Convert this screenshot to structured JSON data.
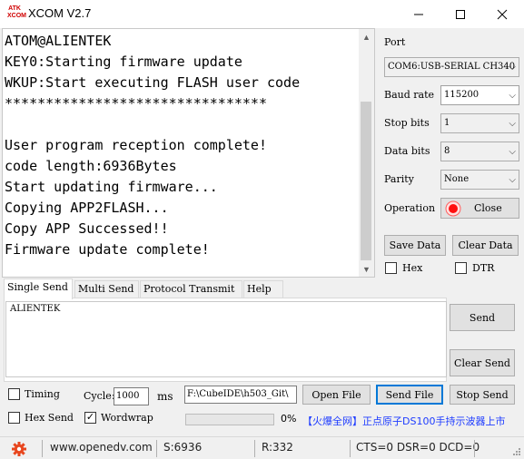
{
  "window": {
    "title": "XCOM V2.7",
    "logo_text": "ATK\nXCOM"
  },
  "receive": {
    "lines": [
      "ATOM@ALIENTEK",
      "KEY0:Starting firmware update",
      "WKUP:Start executing FLASH user code",
      "********************************",
      "",
      "User program reception complete!",
      "code length:6936Bytes",
      "Start updating firmware...",
      "Copying APP2FLASH...",
      "Copy APP Successed!!",
      "Firmware update complete!"
    ]
  },
  "settings": {
    "port_label": "Port",
    "port_value": "COM6:USB-SERIAL CH340",
    "baud_label": "Baud rate",
    "baud_value": "115200",
    "stopbits_label": "Stop bits",
    "stopbits_value": "1",
    "databits_label": "Data bits",
    "databits_value": "8",
    "parity_label": "Parity",
    "parity_value": "None",
    "operation_label": "Operation",
    "operation_button": "Close",
    "save_data": "Save Data",
    "clear_data": "Clear Data",
    "hex_label": "Hex",
    "dtr_label": "DTR"
  },
  "tabs": [
    "Single Send",
    "Multi Send",
    "Protocol Transmit",
    "Help"
  ],
  "send": {
    "text": "ALIENTEK",
    "send_button": "Send",
    "clear_send_button": "Clear Send"
  },
  "bottom": {
    "timing_label": "Timing",
    "cycle_label": "Cycle:",
    "cycle_value": "1000",
    "cycle_unit": "ms",
    "file_path": "F:\\CubeIDE\\h503_Git\\",
    "open_file": "Open File",
    "send_file": "Send File",
    "stop_send": "Stop Send",
    "hex_send_label": "Hex Send",
    "wordwrap_label": "Wordwrap",
    "progress_text": "0%",
    "progress_fraction": 0,
    "ad_text": "【火爆全网】正点原子DS100手持示波器上市"
  },
  "status": {
    "website": "www.openedv.com",
    "sent": "S:6936",
    "received": "R:332",
    "lines": "CTS=0 DSR=0 DCD=0"
  },
  "colors": {
    "accent": "#0078d7",
    "ad_text": "#1e3cff",
    "logo": "#d00000",
    "gear": "#e8461e"
  }
}
